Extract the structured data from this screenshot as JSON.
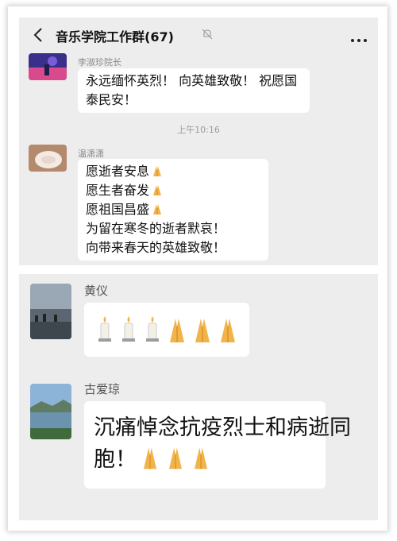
{
  "chat": {
    "title": "音乐学院工作群(67)",
    "messages": [
      {
        "sender": "李淑珍院长",
        "text": "永远缅怀英烈！ 向英雄致敬！ 祝愿国泰民安！"
      },
      {
        "timestamp": "上午10:16"
      },
      {
        "sender": "温潇潇",
        "lines": [
          "愿逝者安息",
          "愿生者奋发",
          "愿祖国昌盛",
          "为留在寒冬的逝者默哀！",
          "向带来春天的英雄致敬！"
        ]
      }
    ]
  },
  "chat2": {
    "messages": [
      {
        "sender": "黄仪",
        "emojis": [
          "candle-emoji",
          "candle-emoji",
          "candle-emoji",
          "praying-hands-emoji",
          "praying-hands-emoji",
          "praying-hands-emoji"
        ]
      },
      {
        "sender": "古爱琼",
        "text_line1": "沉痛悼念抗疫烈士和病逝同",
        "text_line2": "胞！"
      }
    ]
  },
  "icons": {
    "back": "back-arrow-icon",
    "mute": "mute-bell-icon",
    "more": "more-dots-icon"
  },
  "colors": {
    "chat_bg": "#ededed",
    "bubble": "#ffffff",
    "hands": "#f2b34a"
  }
}
